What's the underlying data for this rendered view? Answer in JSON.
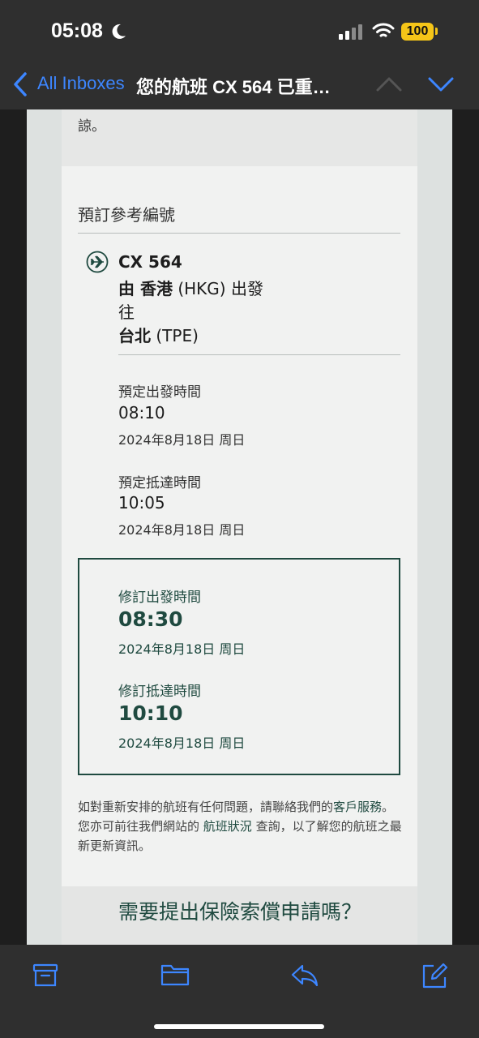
{
  "status": {
    "time": "05:08",
    "battery": "100"
  },
  "nav": {
    "back_label": "All Inboxes",
    "title": "您的航班 CX 564 已重…"
  },
  "email": {
    "prev_text": "諒。",
    "booking_label": "預訂參考編號",
    "flight": {
      "number": "CX 564",
      "from_prefix": "由 香港",
      "from_code": "(HKG) 出發",
      "to_word": "往",
      "to_city": "台北",
      "to_code": "(TPE)"
    },
    "scheduled": {
      "dep_label": "預定出發時間",
      "dep_time": "08:10",
      "dep_date": "2024年8月18日 周日",
      "arr_label": "預定抵達時間",
      "arr_time": "10:05",
      "arr_date": "2024年8月18日 周日"
    },
    "revised": {
      "dep_label": "修訂出發時間",
      "dep_time": "08:30",
      "dep_date": "2024年8月18日 周日",
      "arr_label": "修訂抵達時間",
      "arr_time": "10:10",
      "arr_date": "2024年8月18日 周日"
    },
    "footnote": {
      "part1": "如對重新安排的航班有任何問題，請聯絡我們的",
      "link1": "客戶服務",
      "part2": "。您亦可前往我們網站的 ",
      "link2": "航班狀況",
      "part3": " 查詢，以了解您的航班之最新更新資訊。"
    },
    "claim_heading": "需要提出保險索償申請嗎？"
  },
  "toolbar": {
    "icons": [
      "archive-icon",
      "folder-icon",
      "reply-icon",
      "compose-icon"
    ]
  },
  "colors": {
    "accent": "#3d86ff",
    "brand": "#1f4a40"
  }
}
